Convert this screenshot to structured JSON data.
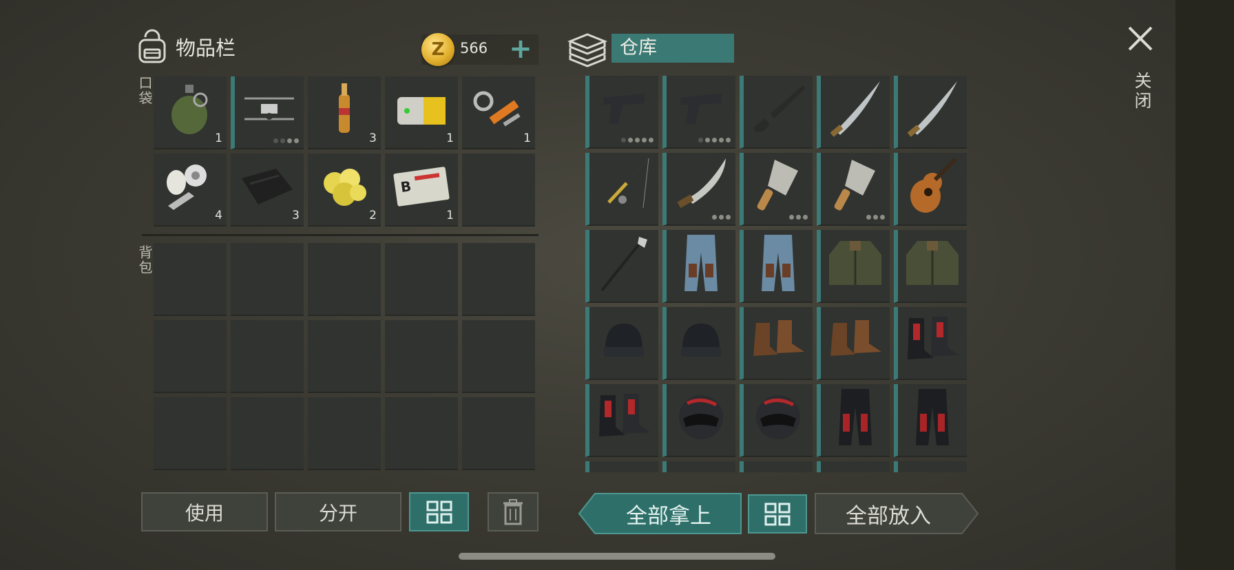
{
  "inventory": {
    "title": "物品栏",
    "coins": "566",
    "coin_symbol": "Z",
    "pocket_label": "口袋",
    "backpack_label": "背包",
    "pocket_slots": [
      {
        "item": "grenade-icon",
        "qty": "1"
      },
      {
        "item": "drone-icon",
        "qty": "",
        "dots": [
          0,
          0,
          1,
          1
        ],
        "accent": true
      },
      {
        "item": "ampoule-icon",
        "qty": "3"
      },
      {
        "item": "battery-icon",
        "qty": "1"
      },
      {
        "item": "hydraulic-parts-icon",
        "qty": "1"
      },
      {
        "item": "mechanical-parts-icon",
        "qty": "4"
      },
      {
        "item": "cloth-icon",
        "qty": "3"
      },
      {
        "item": "gold-ore-icon",
        "qty": "2"
      },
      {
        "item": "id-card-icon",
        "qty": "1"
      },
      {
        "item": "empty",
        "qty": ""
      }
    ],
    "backpack_rows": 3,
    "backpack_cols": 5
  },
  "storage": {
    "title": "仓库",
    "items": [
      {
        "item": "pistol-icon",
        "dots": [
          0,
          1,
          1,
          1,
          1
        ]
      },
      {
        "item": "pistol-icon",
        "dots": [
          0,
          1,
          1,
          1,
          1
        ]
      },
      {
        "item": "rifle-icon"
      },
      {
        "item": "katana-icon"
      },
      {
        "item": "katana-icon"
      },
      {
        "item": "fishing-rod-icon"
      },
      {
        "item": "machete-icon",
        "dots": [
          1,
          1,
          1
        ]
      },
      {
        "item": "cleaver-icon",
        "dots": [
          1,
          1,
          1
        ]
      },
      {
        "item": "cleaver-icon",
        "dots": [
          1,
          1,
          1
        ]
      },
      {
        "item": "guitar-icon"
      },
      {
        "item": "golf-club-icon"
      },
      {
        "item": "jeans-icon"
      },
      {
        "item": "jeans-icon"
      },
      {
        "item": "jacket-icon"
      },
      {
        "item": "jacket-icon"
      },
      {
        "item": "beanie-icon"
      },
      {
        "item": "beanie-icon"
      },
      {
        "item": "brown-boots-icon"
      },
      {
        "item": "brown-boots-icon"
      },
      {
        "item": "moto-boots-icon"
      },
      {
        "item": "moto-boots-icon"
      },
      {
        "item": "moto-helmet-icon"
      },
      {
        "item": "moto-helmet-icon"
      },
      {
        "item": "moto-pants-icon"
      },
      {
        "item": "moto-pants-icon"
      },
      {
        "item": "partial-item-icon"
      },
      {
        "item": "partial-item-icon"
      },
      {
        "item": "partial-item-icon"
      },
      {
        "item": "partial-item-icon"
      },
      {
        "item": "partial-item-icon"
      }
    ]
  },
  "close_label": "关闭",
  "buttons": {
    "use": "使用",
    "split": "分开",
    "take_all": "全部拿上",
    "put_all": "全部放入"
  },
  "colors": {
    "accent": "#3b7a74",
    "coin": "#e3b02e"
  }
}
